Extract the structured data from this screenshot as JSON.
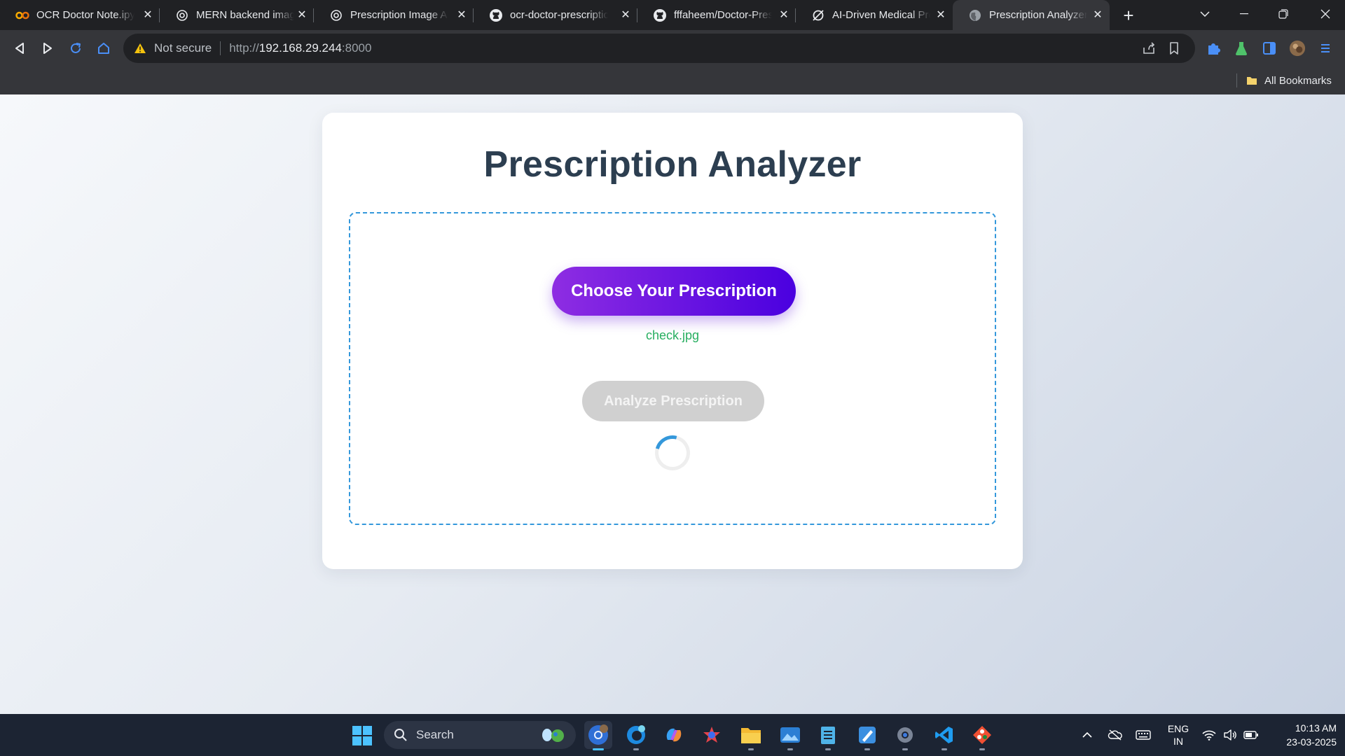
{
  "browser": {
    "tabs": [
      {
        "title": "OCR Doctor Note.ipynb",
        "icon": "colab-icon"
      },
      {
        "title": "MERN backend image",
        "icon": "chatgpt-icon"
      },
      {
        "title": "Prescription Image Analyzer",
        "icon": "chatgpt-icon"
      },
      {
        "title": "ocr-doctor-prescription",
        "icon": "github-icon"
      },
      {
        "title": "fffaheem/Doctor-Prescription",
        "icon": "github-icon"
      },
      {
        "title": "AI-Driven Medical Prescription",
        "icon": "perplexity-icon"
      },
      {
        "title": "Prescription Analyzer",
        "icon": "globe-icon"
      }
    ],
    "address": {
      "security_label": "Not secure",
      "scheme": "http://",
      "host": "192.168.29.244",
      "port": ":8000"
    },
    "bookmarks": {
      "all_label": "All Bookmarks"
    }
  },
  "page": {
    "title": "Prescription Analyzer",
    "choose_label": "Choose Your Prescription",
    "file_name": "check.jpg",
    "analyze_label": "Analyze Prescription",
    "colors": {
      "title": "#2c3e50",
      "dropzone_border": "#3498db",
      "button_gradient_start": "#8e2de2",
      "button_gradient_end": "#4a00e0",
      "file_name": "#27ae60",
      "disabled_button": "#d0d0d0"
    }
  },
  "taskbar": {
    "search_placeholder": "Search",
    "apps": [
      "chrome-icon",
      "edge-icon",
      "copilot-icon",
      "app-icon",
      "file-explorer-icon",
      "photos-icon",
      "notepad-icon",
      "paint-icon",
      "settings-icon",
      "vscode-icon",
      "git-icon"
    ],
    "language": {
      "line1": "ENG",
      "line2": "IN"
    },
    "time": "10:13 AM",
    "date": "23-03-2025"
  }
}
